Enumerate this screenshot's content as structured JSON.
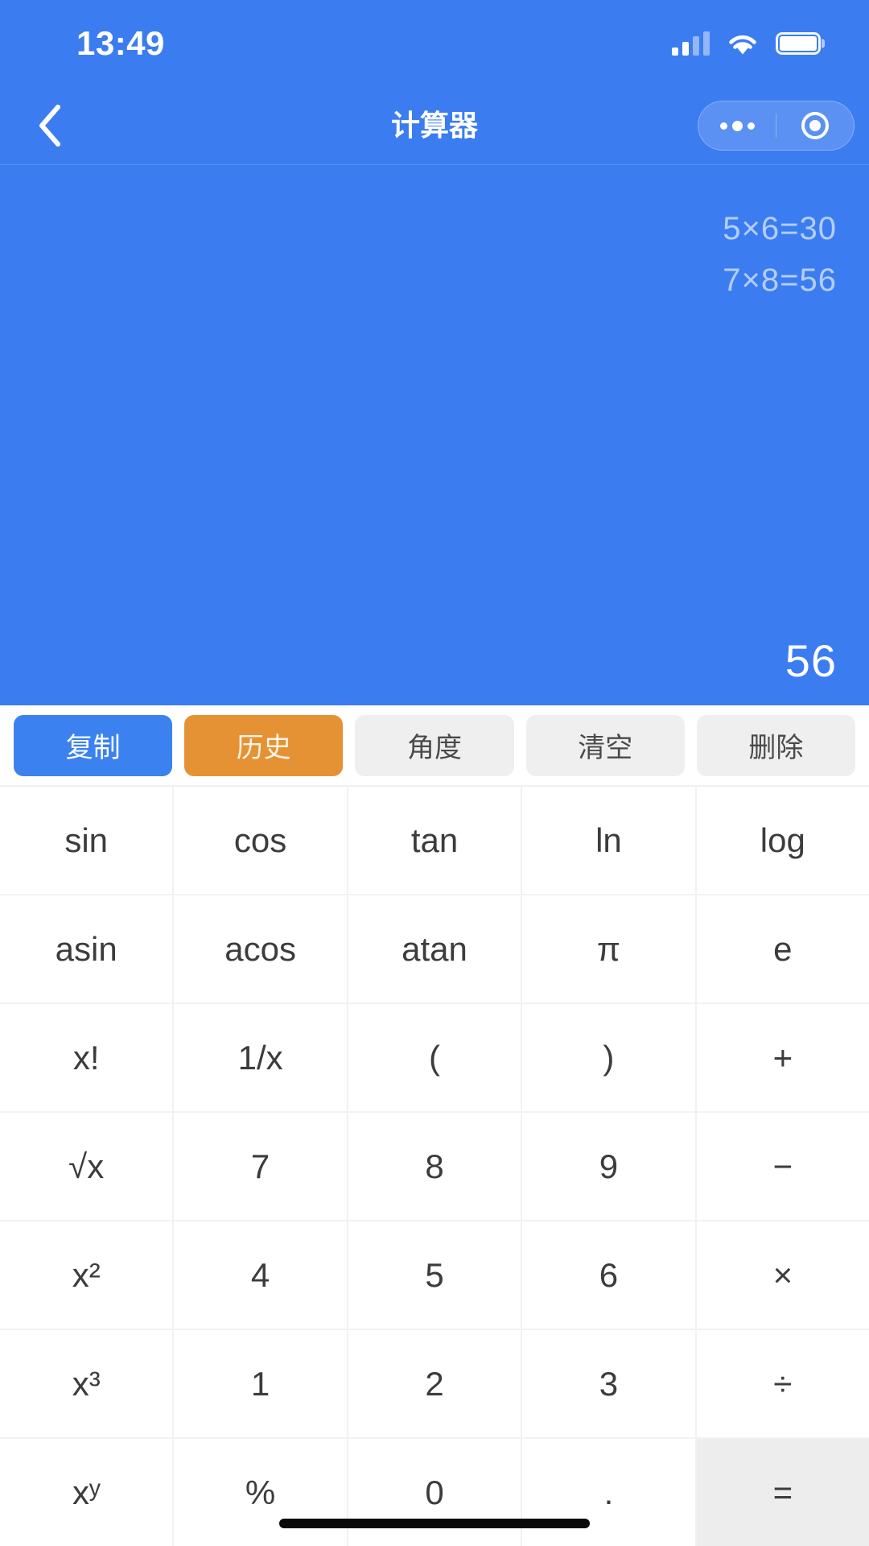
{
  "status_bar": {
    "time": "13:49",
    "signal_icon": "cellular-signal-icon",
    "wifi_icon": "wifi-icon",
    "battery_icon": "battery-icon"
  },
  "nav": {
    "back_icon": "back-chevron-icon",
    "title": "计算器",
    "capsule": {
      "menu_icon": "more-dots-icon",
      "close_icon": "target-circle-icon"
    }
  },
  "display": {
    "history": [
      "5×6=30",
      "7×8=56"
    ],
    "result": "56"
  },
  "toolbar": {
    "buttons": [
      {
        "label": "复制",
        "style": "primary"
      },
      {
        "label": "历史",
        "style": "warn"
      },
      {
        "label": "角度",
        "style": "plain"
      },
      {
        "label": "清空",
        "style": "plain"
      },
      {
        "label": "删除",
        "style": "plain"
      }
    ]
  },
  "keypad": {
    "rows": [
      [
        {
          "label": "sin"
        },
        {
          "label": "cos"
        },
        {
          "label": "tan"
        },
        {
          "label": "ln"
        },
        {
          "label": "log"
        }
      ],
      [
        {
          "label": "asin"
        },
        {
          "label": "acos"
        },
        {
          "label": "atan"
        },
        {
          "label": "π"
        },
        {
          "label": "e"
        }
      ],
      [
        {
          "label": "x!"
        },
        {
          "label": "1/x"
        },
        {
          "label": "("
        },
        {
          "label": ")"
        },
        {
          "label": "+"
        }
      ],
      [
        {
          "label": "√x"
        },
        {
          "label": "7"
        },
        {
          "label": "8"
        },
        {
          "label": "9"
        },
        {
          "label": "−"
        }
      ],
      [
        {
          "label": "x²"
        },
        {
          "label": "4"
        },
        {
          "label": "5"
        },
        {
          "label": "6"
        },
        {
          "label": "×"
        }
      ],
      [
        {
          "label": "x³"
        },
        {
          "label": "1"
        },
        {
          "label": "2"
        },
        {
          "label": "3"
        },
        {
          "label": "÷"
        }
      ],
      [
        {
          "label": "xʸ"
        },
        {
          "label": "%"
        },
        {
          "label": "0"
        },
        {
          "label": "."
        },
        {
          "label": "=",
          "style": "equals"
        }
      ]
    ]
  },
  "home_indicator": "home-indicator-bar",
  "colors": {
    "brand_blue": "#3B7DF0",
    "button_blue": "#3B82F0",
    "button_orange": "#E59235",
    "button_grey": "#EFEFEF",
    "key_text": "#3C3C3C",
    "equals_bg": "#EDEDED"
  }
}
